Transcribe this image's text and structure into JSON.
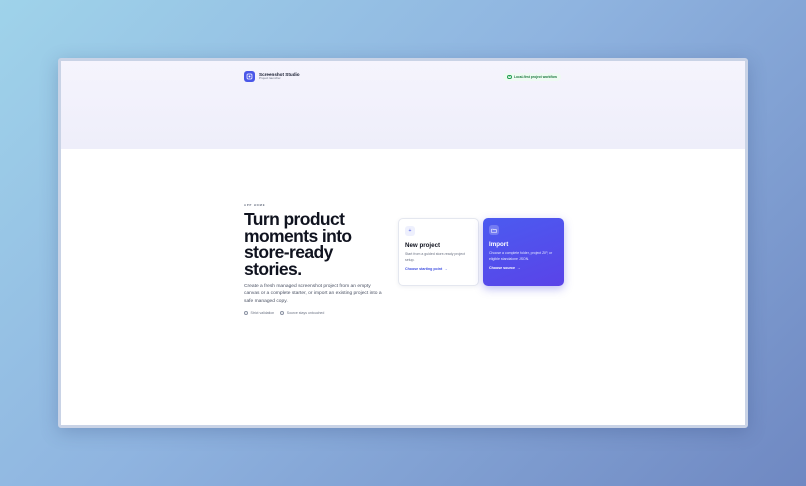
{
  "header": {
    "app_name": "Screenshot Studio",
    "app_subtitle": "Project launcher",
    "status_label": "Local-first project workflow"
  },
  "hero": {
    "eyebrow": "App Home",
    "headline": "Turn product moments into store-ready stories.",
    "description": "Create a fresh managed screenshot project from an empty canvas or a complete starter, or import an existing project into a safe managed copy.",
    "meta": [
      {
        "icon": "shield-check-icon",
        "label": "Strict validation"
      },
      {
        "icon": "lock-icon",
        "label": "Source stays untouched"
      }
    ]
  },
  "cards": {
    "new_project": {
      "icon": "plus-icon",
      "title": "New project",
      "description": "Start from a guided store-ready project setup.",
      "link": "Choose starting point"
    },
    "import": {
      "icon": "folder-icon",
      "title": "Import",
      "description": "Choose a complete folder, project ZIP, or eligible standalone JSON.",
      "link": "Choose source"
    }
  },
  "colors": {
    "accent": "#4a57e8",
    "status_green": "#22a052"
  }
}
